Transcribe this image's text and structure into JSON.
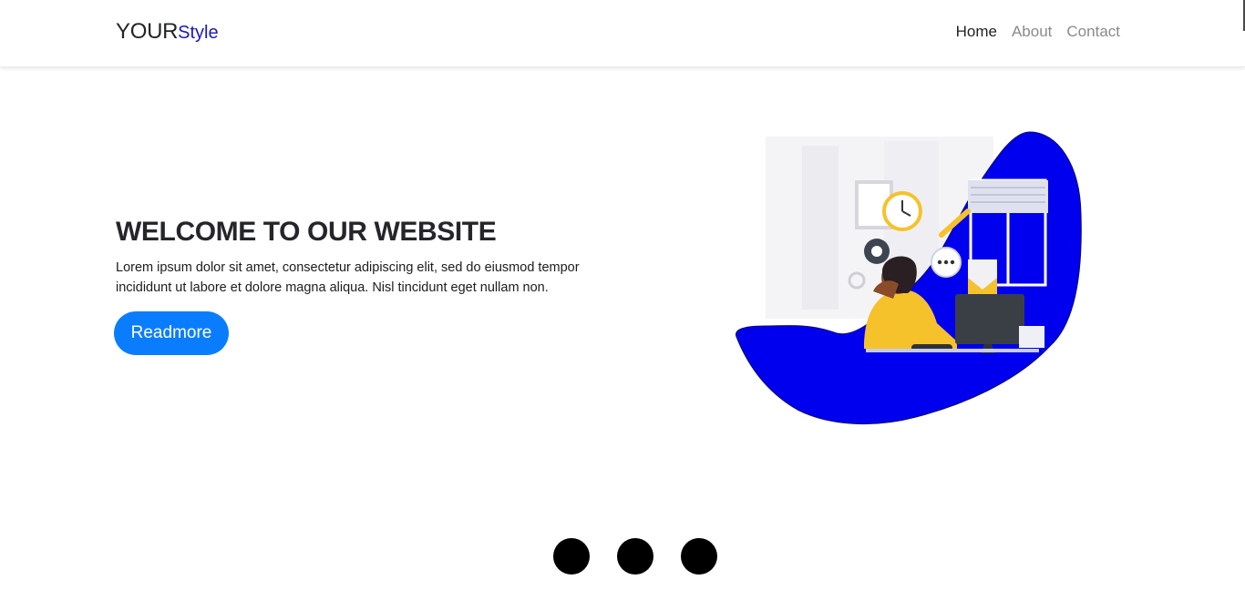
{
  "brand": {
    "main": "YOUR",
    "accent": "Style"
  },
  "nav": {
    "items": [
      "Home",
      "About",
      "Contact"
    ],
    "active": "Home"
  },
  "hero": {
    "title": "WELCOME TO OUR WEBSITE",
    "text": "Lorem ipsum dolor sit amet, consectetur adipiscing elit, sed do eiusmod tempor incididunt ut labore et dolore magna aliqua. Nisl tincidunt eget nullam non.",
    "button_label": "Readmore"
  },
  "illustration": {
    "icon": "support-agent-at-computer-illustration",
    "blob_color": "#0000ee",
    "accent_color": "#f5c22b"
  },
  "carousel": {
    "dot_count": 3
  },
  "colors": {
    "primary_button": "#0a7dff",
    "brand_accent": "#1a1ab8",
    "nav_inactive": "#8a8a8a"
  }
}
